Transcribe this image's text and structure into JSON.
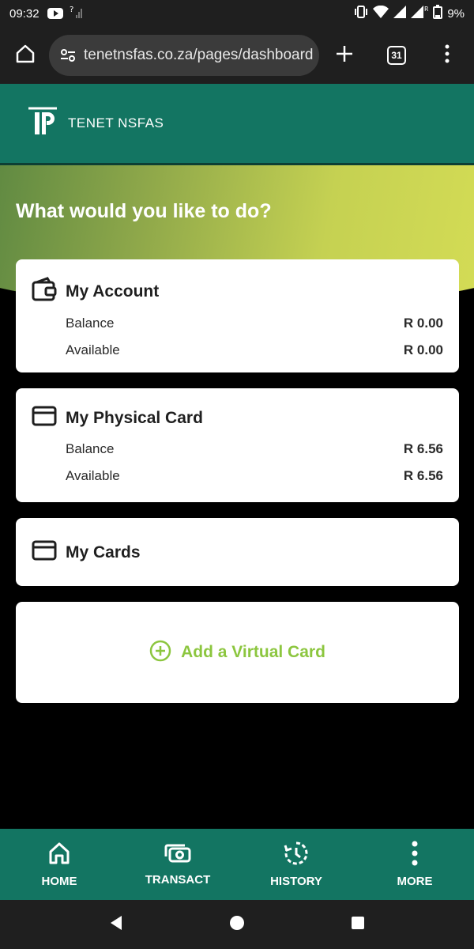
{
  "status_bar": {
    "time": "09:32",
    "battery": "9%",
    "icons": [
      "youtube-icon",
      "signal-unknown-icon",
      "vibrate-icon",
      "wifi-icon",
      "signal-icon",
      "signal-roaming-icon",
      "battery-icon"
    ]
  },
  "browser": {
    "url": "tenetnsfas.co.za/pages/dashboard",
    "tab_count": "31",
    "icons": [
      "home-icon",
      "site-settings-icon",
      "new-tab-icon",
      "tabs-icon",
      "menu-icon"
    ]
  },
  "app": {
    "brand": "TENET NSFAS",
    "logo_text": "TP",
    "hero_title": "What would you like to do?"
  },
  "cards": {
    "account": {
      "title": "My Account",
      "icon": "wallet-icon",
      "balance_label": "Balance",
      "balance_value": "R 0.00",
      "available_label": "Available",
      "available_value": "R 0.00"
    },
    "physical": {
      "title": "My Physical Card",
      "icon": "credit-card-icon",
      "balance_label": "Balance",
      "balance_value": "R 6.56",
      "available_label": "Available",
      "available_value": "R 6.56"
    },
    "cards": {
      "title": "My Cards",
      "icon": "credit-card-icon"
    },
    "add_virtual": {
      "label": "Add a Virtual Card",
      "icon": "plus-circle-icon"
    }
  },
  "bottom_nav": [
    {
      "label": "HOME",
      "icon": "home-icon"
    },
    {
      "label": "TRANSACT",
      "icon": "money-icon"
    },
    {
      "label": "HISTORY",
      "icon": "history-icon"
    },
    {
      "label": "MORE",
      "icon": "more-vertical-icon"
    }
  ],
  "colors": {
    "brand_green": "#137562",
    "accent_lime": "#8cc63f",
    "gradient_start": "#4e7e3f",
    "gradient_end": "#d8df56"
  }
}
